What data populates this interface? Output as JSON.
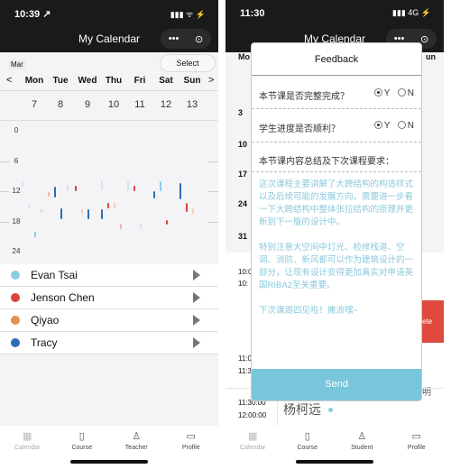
{
  "left": {
    "status": {
      "time": "10:39 ↗",
      "icons": "▮▮▮ ᯤ ⚡"
    },
    "nav": {
      "title": "My Calendar",
      "more": "•••",
      "target": "⊙"
    },
    "month": "Mar",
    "select_label": "Select",
    "prev": "<",
    "next": ">",
    "weekdays": [
      "Mon",
      "Tue",
      "Wed",
      "Thu",
      "Fri",
      "Sat",
      "Sun"
    ],
    "dates": [
      "7",
      "8",
      "9",
      "10",
      "11",
      "12",
      "13"
    ],
    "hours": [
      "0",
      "6",
      "12",
      "18",
      "24"
    ],
    "students": [
      {
        "name": "Evan Tsai",
        "color": "#8ecbe6"
      },
      {
        "name": "Jenson Chen",
        "color": "#d9453a"
      },
      {
        "name": "Qiyao",
        "color": "#e8904a"
      },
      {
        "name": "Tracy",
        "color": "#2f6db5"
      }
    ],
    "events": [
      {
        "day": 0,
        "start": 10,
        "end": 11,
        "s": 0,
        "faded": true
      },
      {
        "day": 0,
        "start": 14.6,
        "end": 15.3,
        "s": 0,
        "faded": true
      },
      {
        "day": 0,
        "start": 20,
        "end": 21,
        "s": 0,
        "faded": false
      },
      {
        "day": 0,
        "start": 15.5,
        "end": 16.3,
        "s": 2,
        "faded": true
      },
      {
        "day": 1,
        "start": 12.2,
        "end": 13.1,
        "s": 1,
        "faded": true
      },
      {
        "day": 1,
        "start": 11,
        "end": 13.3,
        "s": 3,
        "faded": false
      },
      {
        "day": 1,
        "start": 15.4,
        "end": 17.5,
        "s": 3,
        "faded": false
      },
      {
        "day": 1,
        "start": 10.7,
        "end": 11.9,
        "s": 0,
        "faded": true
      },
      {
        "day": 2,
        "start": 10.9,
        "end": 12,
        "s": 1,
        "faded": false
      },
      {
        "day": 2,
        "start": 15.5,
        "end": 16.5,
        "s": 2,
        "faded": true
      },
      {
        "day": 2,
        "start": 15.5,
        "end": 17.5,
        "s": 3,
        "faded": false
      },
      {
        "day": 3,
        "start": 10,
        "end": 11.7,
        "s": 0,
        "faded": true
      },
      {
        "day": 3,
        "start": 14.3,
        "end": 15.3,
        "s": 1,
        "faded": false
      },
      {
        "day": 3,
        "start": 14.3,
        "end": 15.3,
        "s": 2,
        "faded": true
      },
      {
        "day": 3,
        "start": 18.4,
        "end": 19.4,
        "s": 1,
        "faded": true
      },
      {
        "day": 3,
        "start": 15.5,
        "end": 17.5,
        "s": 3,
        "faded": false
      },
      {
        "day": 4,
        "start": 10,
        "end": 11.7,
        "s": 0,
        "faded": true
      },
      {
        "day": 4,
        "start": 10.9,
        "end": 12,
        "s": 1,
        "faded": false
      },
      {
        "day": 4,
        "start": 18.4,
        "end": 19.4,
        "s": 0,
        "faded": true
      },
      {
        "day": 5,
        "start": 11.9,
        "end": 13.4,
        "s": 3,
        "faded": false
      },
      {
        "day": 5,
        "start": 10,
        "end": 12,
        "s": 0,
        "faded": false
      },
      {
        "day": 5,
        "start": 17.6,
        "end": 18.6,
        "s": 1,
        "faded": false
      },
      {
        "day": 6,
        "start": 10.3,
        "end": 13.6,
        "s": 3,
        "faded": false
      },
      {
        "day": 6,
        "start": 14.3,
        "end": 16.1,
        "s": 1,
        "faded": false
      },
      {
        "day": 6,
        "start": 15.4,
        "end": 16.5,
        "s": 2,
        "faded": true
      }
    ],
    "tabs": [
      {
        "label": "Calendar",
        "icon": "▦"
      },
      {
        "label": "Course",
        "icon": "▯"
      },
      {
        "label": "Teacher",
        "icon": "♙"
      },
      {
        "label": "Profile",
        "icon": "▭"
      }
    ]
  },
  "right": {
    "status": {
      "time": "11:30",
      "icons": "▮▮▮ 4G ⚡"
    },
    "nav": {
      "title": "My Calendar",
      "more": "•••",
      "target": "⊙"
    },
    "bg": {
      "mo": "Mo",
      "un": "un",
      "dates": [
        "3",
        "10",
        "17",
        "24",
        "31"
      ],
      "t1": "10:0",
      "t2": "10:",
      "delete": "ete",
      "t3": "11:0",
      "t4": "11:3",
      "ming": "明",
      "t5": "11:30:00",
      "t6": "12:00:00",
      "student": "杨柯远"
    },
    "modal": {
      "title": "Feedback",
      "q1": "本节课是否完整完成？",
      "q2": "学生进度是否顺利？",
      "yes": "Y",
      "no": "N",
      "q3": "本节课内容总结及下次课程要求：",
      "text": "这次课程主要讲解了大跨结构的构造样式以及后续可能的发展方向。需要进一步看一下大跨结构中整体张拉结构的原理并更新到下一版的设计中。\n\n特别注意大空间中灯光、检修栈道、空调、消防、新风都可以作为建筑设计的一部分，让现有设计变得更加真实对申请英国RIBA2至关重要。\n\n下次课周四见啦！撒浪嘿~",
      "send": "Send"
    },
    "tabs": [
      {
        "label": "Calendar",
        "icon": "▦"
      },
      {
        "label": "Course",
        "icon": "▯"
      },
      {
        "label": "Student",
        "icon": "♙"
      },
      {
        "label": "Profile",
        "icon": "▭"
      }
    ]
  }
}
